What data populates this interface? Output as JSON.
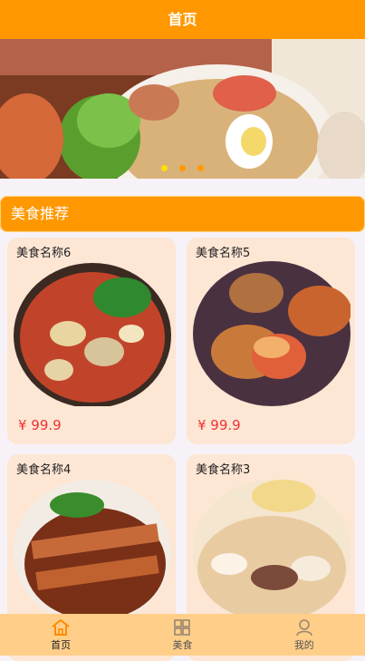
{
  "header": {
    "title": "首页"
  },
  "banner": {
    "dots": 3,
    "active_dot": 0
  },
  "section": {
    "title": "美食推荐"
  },
  "foods": [
    {
      "name": "美食名称6",
      "price": "¥ 99.9"
    },
    {
      "name": "美食名称5",
      "price": "¥ 99.9"
    },
    {
      "name": "美食名称4",
      "price": ""
    },
    {
      "name": "美食名称3",
      "price": ""
    }
  ],
  "tabbar": {
    "items": [
      {
        "label": "首页",
        "icon": "home-icon",
        "active": true
      },
      {
        "label": "美食",
        "icon": "grid-icon",
        "active": false
      },
      {
        "label": "我的",
        "icon": "user-icon",
        "active": false
      }
    ]
  },
  "colors": {
    "primary": "#ff9800",
    "tab_active": "#ff9800",
    "price": "#e33333",
    "card_bg": "#fde6d4"
  }
}
